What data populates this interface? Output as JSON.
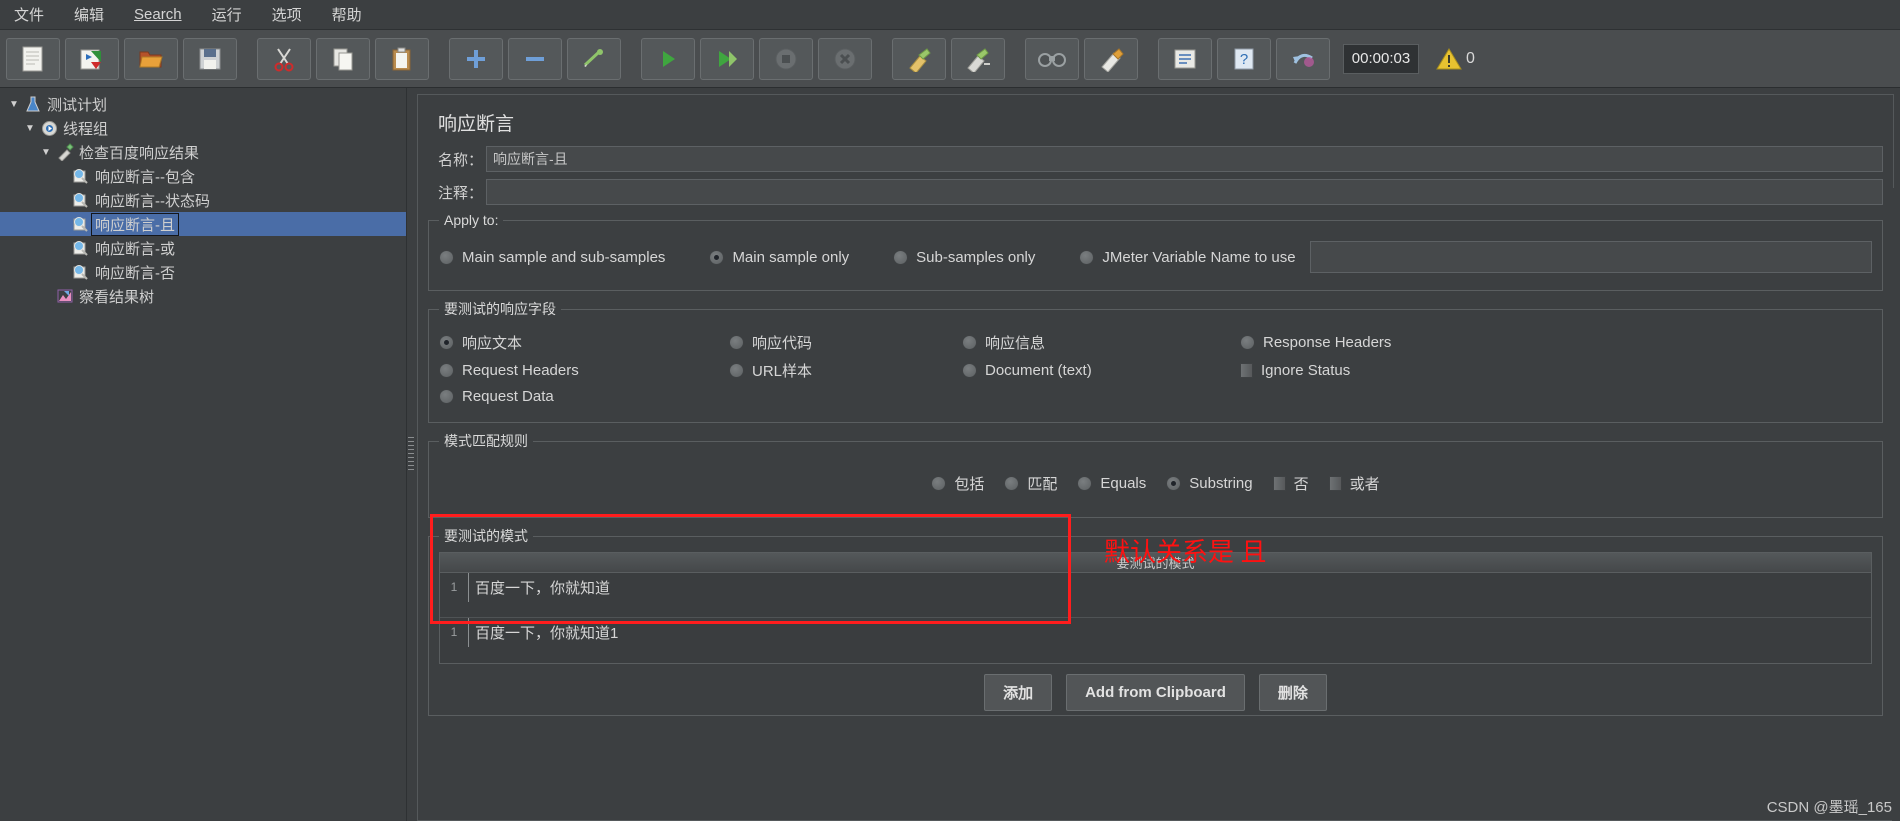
{
  "menu": {
    "items": [
      {
        "label": "文件"
      },
      {
        "label": "编辑"
      },
      {
        "label": "Search",
        "mnemonic": "S"
      },
      {
        "label": "运行"
      },
      {
        "label": "选项"
      },
      {
        "label": "帮助"
      }
    ]
  },
  "toolbar": {
    "buttons": [
      {
        "name": "new-icon",
        "title": "新建"
      },
      {
        "name": "templates-icon",
        "title": "模板"
      },
      {
        "name": "open-icon",
        "title": "打开"
      },
      {
        "name": "save-icon",
        "title": "保存"
      },
      {
        "name": "cut-icon",
        "title": "剪切"
      },
      {
        "name": "copy-icon",
        "title": "复制"
      },
      {
        "name": "paste-icon",
        "title": "粘贴"
      },
      {
        "name": "expand-all-icon",
        "title": "展开"
      },
      {
        "name": "collapse-all-icon",
        "title": "收起"
      },
      {
        "name": "toggle-icon",
        "title": "切换"
      },
      {
        "name": "start-icon",
        "title": "启动"
      },
      {
        "name": "start-no-pause-icon",
        "title": "无暂停启动"
      },
      {
        "name": "stop-icon",
        "title": "停止"
      },
      {
        "name": "shutdown-icon",
        "title": "关闭"
      },
      {
        "name": "clear-icon",
        "title": "清除"
      },
      {
        "name": "clear-all-icon",
        "title": "清除全部"
      },
      {
        "name": "search-icon",
        "title": "查找"
      },
      {
        "name": "reset-search-icon",
        "title": "重置查找"
      },
      {
        "name": "function-helper-icon",
        "title": "函数助手"
      },
      {
        "name": "help-icon",
        "title": "帮助"
      },
      {
        "name": "undo-icon",
        "title": "撤销"
      }
    ],
    "timer": "00:00:03",
    "warning_count": "0"
  },
  "tree": {
    "nodes": [
      {
        "label": "测试计划",
        "icon": "test-plan-icon",
        "indent": 0,
        "expanded": true,
        "selected": false
      },
      {
        "label": "线程组",
        "icon": "thread-group-icon",
        "indent": 1,
        "expanded": true,
        "selected": false
      },
      {
        "label": "检查百度响应结果",
        "icon": "http-sampler-icon",
        "indent": 2,
        "expanded": true,
        "selected": false
      },
      {
        "label": "响应断言--包含",
        "icon": "assertion-icon",
        "indent": 3,
        "expanded": null,
        "selected": false
      },
      {
        "label": "响应断言--状态码",
        "icon": "assertion-icon",
        "indent": 3,
        "expanded": null,
        "selected": false
      },
      {
        "label": "响应断言-且",
        "icon": "assertion-icon",
        "indent": 3,
        "expanded": null,
        "selected": true
      },
      {
        "label": "响应断言-或",
        "icon": "assertion-icon",
        "indent": 3,
        "expanded": null,
        "selected": false
      },
      {
        "label": "响应断言-否",
        "icon": "assertion-icon",
        "indent": 3,
        "expanded": null,
        "selected": false
      },
      {
        "label": "察看结果树",
        "icon": "view-results-tree-icon",
        "indent": 2,
        "expanded": null,
        "selected": false
      }
    ]
  },
  "panel": {
    "title": "响应断言",
    "name_label": "名称：",
    "name_value": "响应断言-且",
    "comment_label": "注释：",
    "comment_value": "",
    "apply_to": {
      "legend": "Apply to:",
      "options": [
        {
          "label": "Main sample and sub-samples",
          "selected": false
        },
        {
          "label": "Main sample only",
          "selected": true
        },
        {
          "label": "Sub-samples only",
          "selected": false
        },
        {
          "label": "JMeter Variable Name to use",
          "selected": false
        }
      ],
      "variable_value": ""
    },
    "response_field": {
      "legend": "要测试的响应字段",
      "row1": [
        {
          "label": "响应文本",
          "type": "radio",
          "selected": true
        },
        {
          "label": "响应代码",
          "type": "radio",
          "selected": false
        },
        {
          "label": "响应信息",
          "type": "radio",
          "selected": false
        },
        {
          "label": "Response Headers",
          "type": "radio",
          "selected": false
        }
      ],
      "row2": [
        {
          "label": "Request Headers",
          "type": "radio",
          "selected": false
        },
        {
          "label": "URL样本",
          "type": "radio",
          "selected": false
        },
        {
          "label": "Document (text)",
          "type": "radio",
          "selected": false
        },
        {
          "label": "Ignore Status",
          "type": "checkbox",
          "selected": false
        }
      ],
      "row3": [
        {
          "label": "Request Data",
          "type": "radio",
          "selected": false
        }
      ]
    },
    "pattern_rules": {
      "legend": "模式匹配规则",
      "options": [
        {
          "label": "包括",
          "type": "radio",
          "selected": false
        },
        {
          "label": "匹配",
          "type": "radio",
          "selected": false
        },
        {
          "label": "Equals",
          "type": "radio",
          "selected": false
        },
        {
          "label": "Substring",
          "type": "radio",
          "selected": true
        },
        {
          "label": "否",
          "type": "checkbox",
          "selected": false
        },
        {
          "label": "或者",
          "type": "checkbox",
          "selected": false
        }
      ]
    },
    "patterns": {
      "legend": "要测试的模式",
      "column_header": "要测试的模式",
      "rows": [
        {
          "num": "1",
          "value": "百度一下，你就知道"
        },
        {
          "num": "1",
          "value": "百度一下，你就知道1"
        }
      ],
      "buttons": [
        {
          "label": "添加",
          "name": "add-button"
        },
        {
          "label": "Add from Clipboard",
          "name": "add-from-clipboard-button"
        },
        {
          "label": "删除",
          "name": "delete-button"
        }
      ]
    }
  },
  "annotation": {
    "text": "默认关系是  且",
    "color": "#ff1111"
  },
  "watermark": "CSDN @墨瑶_165"
}
